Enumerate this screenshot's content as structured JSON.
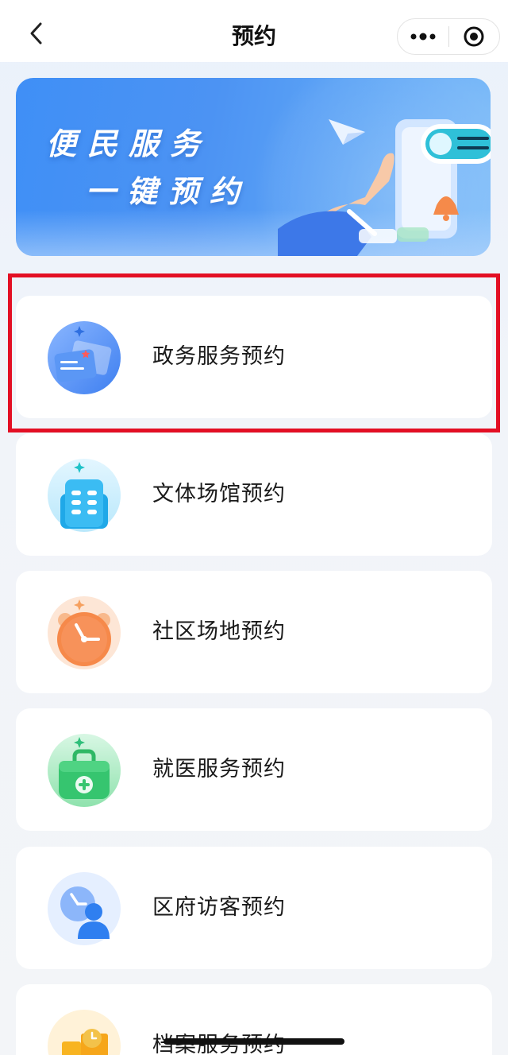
{
  "nav": {
    "title": "预约",
    "back_icon": "chevron-left-icon",
    "more_icon": "more-dots-icon",
    "close_icon": "target-circle-icon"
  },
  "banner": {
    "line1": "便民服务",
    "line2": "一键预约",
    "illustration": "hand-holding-phone-illustration"
  },
  "services": [
    {
      "label": "政务服务预约",
      "icon": "documents-icon",
      "color": "#4f8cf3"
    },
    {
      "label": "文体场馆预约",
      "icon": "building-icon",
      "color": "#33b8f0"
    },
    {
      "label": "社区场地预约",
      "icon": "clock-icon",
      "color": "#f7894a"
    },
    {
      "label": "就医服务预约",
      "icon": "medical-kit-icon",
      "color": "#3fce74"
    },
    {
      "label": "区府访客预约",
      "icon": "visitor-clock-icon",
      "color": "#3d86f0"
    },
    {
      "label": "档案服务预约",
      "icon": "archive-icon",
      "color": "#f8b421"
    }
  ],
  "colors": {
    "highlight": "#e30f24",
    "banner_blue": "#3f8ff6",
    "page_bg": "#f1f4f9"
  }
}
